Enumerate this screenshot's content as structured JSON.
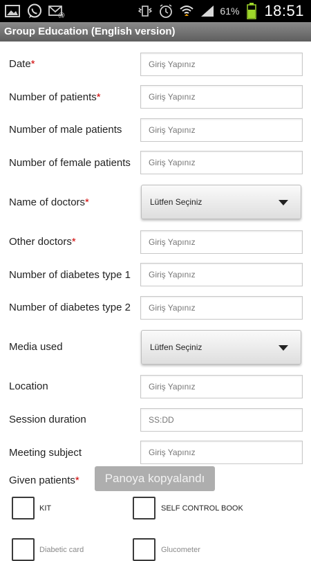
{
  "status_bar": {
    "icons_left": [
      "image-icon",
      "whatsapp-icon",
      "email-icon"
    ],
    "icons_right": [
      "vibrate-icon",
      "alarm-icon",
      "wifi-icon",
      "signal-icon",
      "battery-icon"
    ],
    "battery_percent": "61%",
    "time": "18:51"
  },
  "title": "Group Education (English version)",
  "required_mark": "*",
  "fields": {
    "date": {
      "label": "Date",
      "placeholder": "Giriş Yapınız"
    },
    "patients": {
      "label": "Number of patients",
      "placeholder": "Giriş Yapınız"
    },
    "male": {
      "label": "Number of male patients",
      "placeholder": "Giriş Yapınız"
    },
    "female": {
      "label": "Number of female patients",
      "placeholder": "Giriş Yapınız"
    },
    "doctors": {
      "label": "Name of doctors",
      "value": "Lütfen Seçiniz"
    },
    "other_doctors": {
      "label": "Other doctors",
      "placeholder": "Giriş Yapınız"
    },
    "diabetes1": {
      "label": "Number of diabetes type 1",
      "placeholder": "Giriş Yapınız"
    },
    "diabetes2": {
      "label": "Number of diabetes type 2",
      "placeholder": "Giriş Yapınız"
    },
    "media": {
      "label": "Media used",
      "value": "Lütfen Seçiniz"
    },
    "location": {
      "label": "Location",
      "placeholder": "Giriş Yapınız"
    },
    "duration": {
      "label": "Session duration",
      "placeholder": "SS:DD"
    },
    "subject": {
      "label": "Meeting subject",
      "placeholder": "Giriş Yapınız"
    },
    "given_patients": {
      "label": "Given patients"
    }
  },
  "checkboxes": [
    "KIT",
    "SELF CONTROL BOOK",
    "Diabetic card",
    "Glucometer"
  ],
  "toast": "Panoya kopyalandı"
}
